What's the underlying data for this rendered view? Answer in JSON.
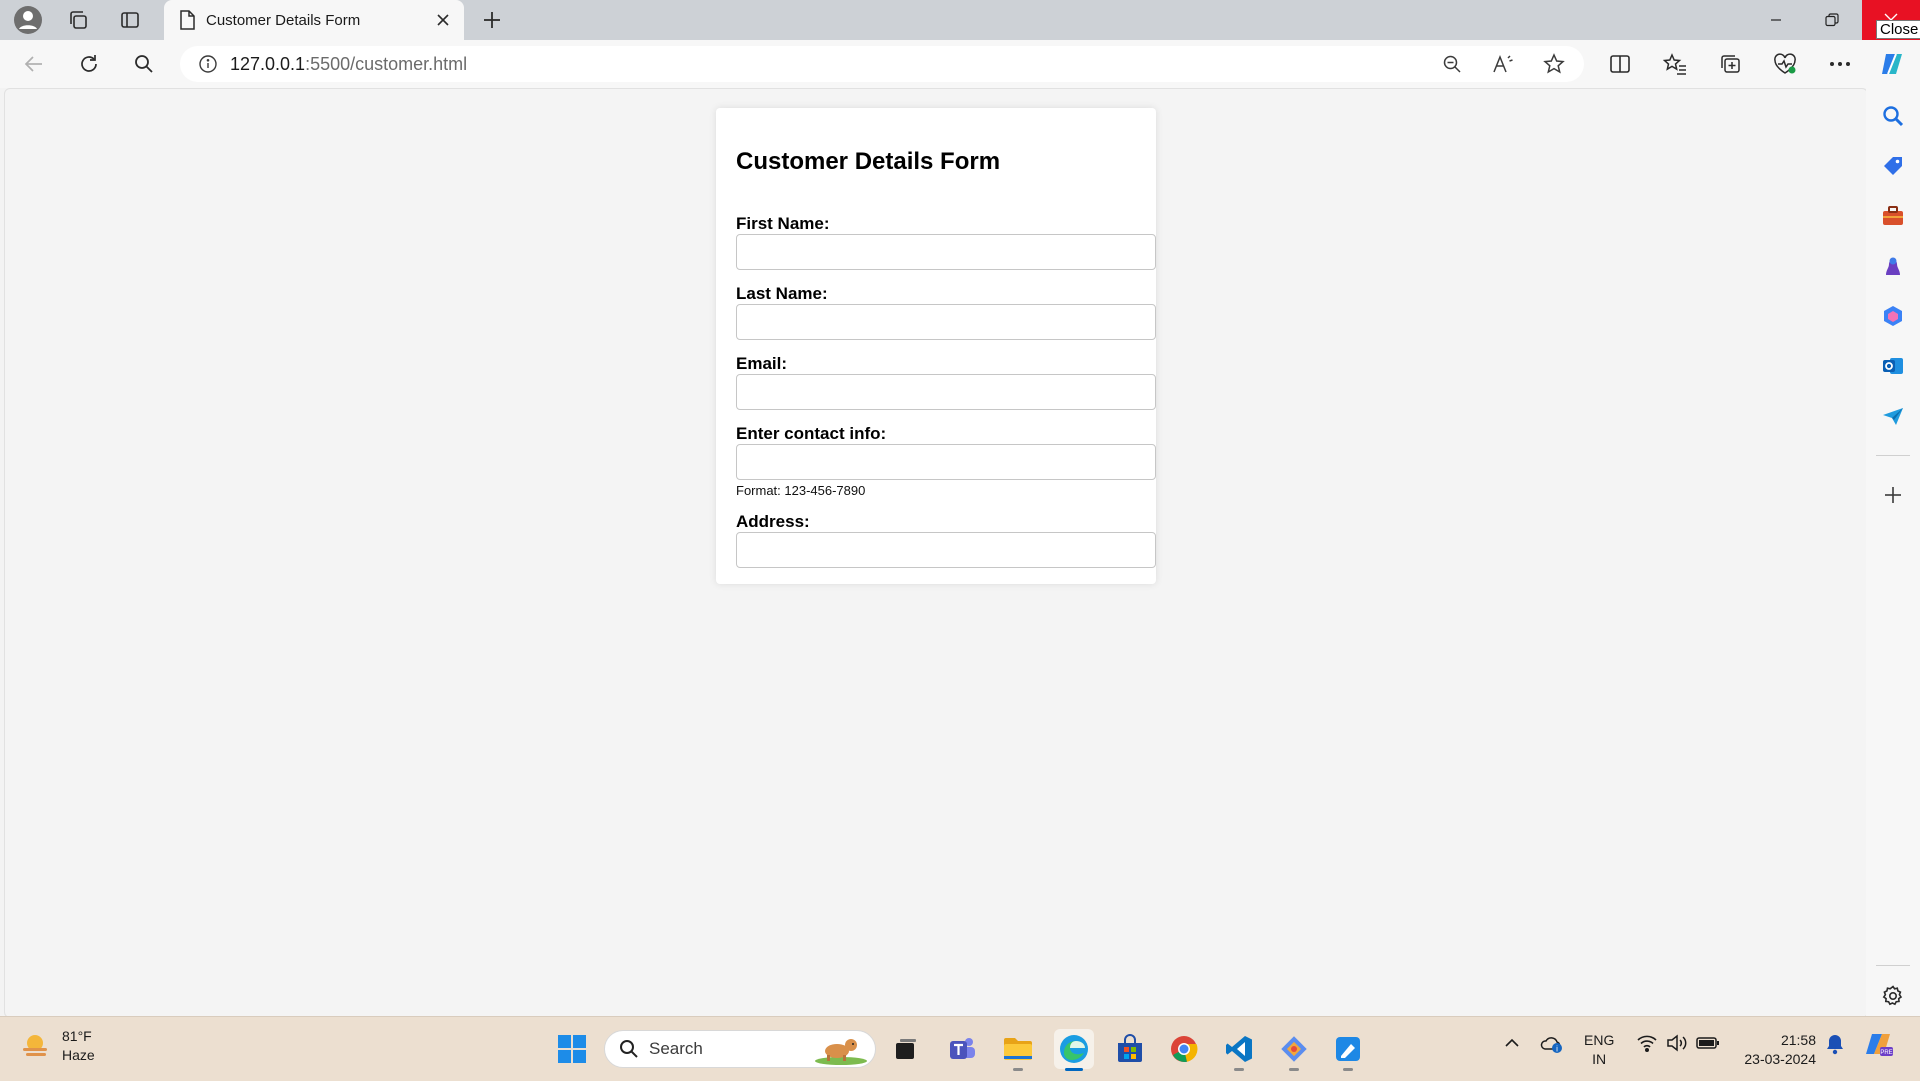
{
  "browser": {
    "tab_title": "Customer Details Form",
    "url_host": "127.0.0.1",
    "url_rest": ":5500/customer.html",
    "close_tooltip": "Close"
  },
  "form": {
    "title": "Customer Details Form",
    "fields": [
      {
        "label": "First Name:",
        "value": ""
      },
      {
        "label": "Last Name:",
        "value": ""
      },
      {
        "label": "Email:",
        "value": ""
      },
      {
        "label": "Enter contact info:",
        "value": "",
        "hint": "Format: 123-456-7890"
      },
      {
        "label": "Address:",
        "value": ""
      }
    ]
  },
  "taskbar": {
    "weather_temp": "81°F",
    "weather_desc": "Haze",
    "search_placeholder": "Search",
    "lang_line1": "ENG",
    "lang_line2": "IN",
    "time": "21:58",
    "date": "23-03-2024"
  },
  "icons": {
    "browser": [
      "profile-icon",
      "workspaces-icon",
      "tab-actions-icon",
      "page-icon",
      "close-tab-icon",
      "new-tab-icon",
      "back-icon",
      "refresh-icon",
      "search-icon",
      "site-info-icon",
      "zoom-out-icon",
      "read-aloud-icon",
      "favorite-star-icon",
      "split-screen-icon",
      "favorites-icon",
      "collections-icon",
      "browser-essentials-icon",
      "more-icon",
      "copilot-icon"
    ],
    "sidebar": [
      "search-icon",
      "shopping-icon",
      "tools-icon",
      "games-icon",
      "microsoft365-icon",
      "outlook-icon",
      "send-icon",
      "add-icon",
      "settings-icon"
    ],
    "taskbar": [
      "weather-icon",
      "start-icon",
      "search-icon",
      "task-view-icon",
      "teams-icon",
      "file-explorer-icon",
      "edge-icon",
      "store-icon",
      "chrome-icon",
      "vscode-icon",
      "git-icon",
      "app-icon",
      "chevron-up-icon",
      "onedrive-icon",
      "wifi-icon",
      "volume-icon",
      "battery-icon",
      "notification-bell-icon",
      "copilot-icon"
    ]
  },
  "colors": {
    "close_button": "#e81123",
    "accent": "#0067c0",
    "page_bg": "#f4f4f4"
  }
}
